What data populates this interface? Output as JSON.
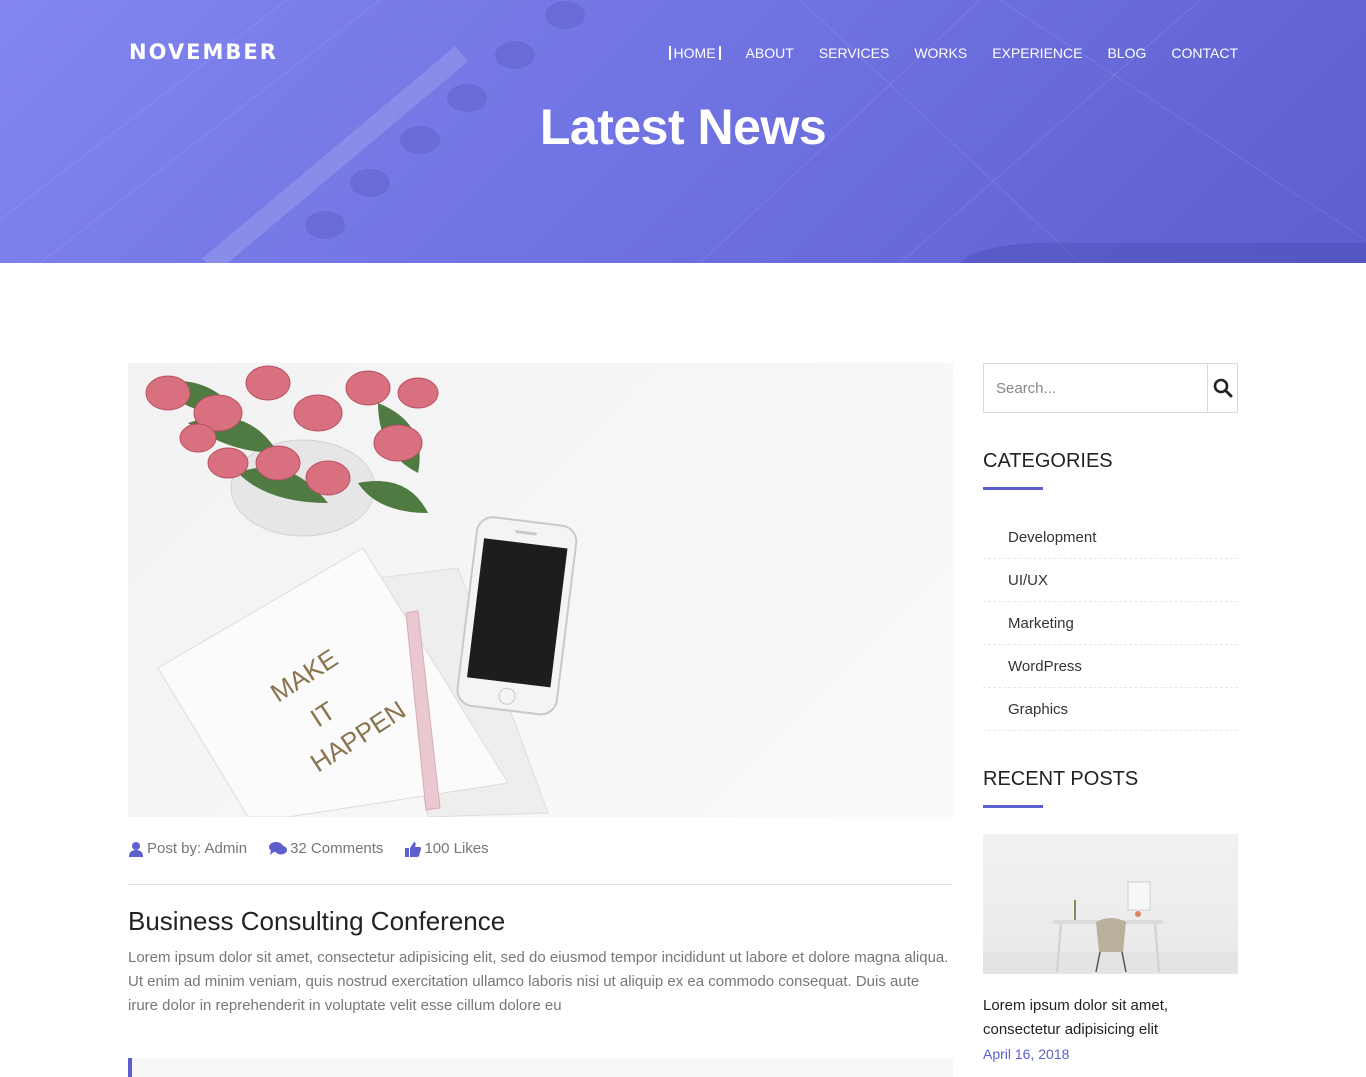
{
  "brand": "NOVEMBER",
  "nav": [
    {
      "label": "HOME",
      "active": true
    },
    {
      "label": "ABOUT"
    },
    {
      "label": "SERVICES"
    },
    {
      "label": "WORKS"
    },
    {
      "label": "EXPERIENCE"
    },
    {
      "label": "BLOG"
    },
    {
      "label": "CONTACT"
    }
  ],
  "hero": {
    "title": "Latest News"
  },
  "post": {
    "image_text": "MAKE IT HAPPEN",
    "meta": {
      "author": "Post by: Admin",
      "comments": "32 Comments",
      "likes": "100 Likes"
    },
    "title": "Business Consulting Conference",
    "excerpt": "Lorem ipsum dolor sit amet, consectetur adipisicing elit, sed do eiusmod tempor incididunt ut labore et dolore magna aliqua. Ut enim ad minim veniam, quis nostrud exercitation ullamco laboris nisi ut aliquip ex ea commodo consequat. Duis aute irure dolor in reprehenderit in voluptate velit esse cillum dolore eu"
  },
  "sidebar": {
    "search_placeholder": "Search...",
    "categories_title": "CATEGORIES",
    "categories": [
      "Development",
      "UI/UX",
      "Marketing",
      "WordPress",
      "Graphics"
    ],
    "recent_title": "RECENT POSTS",
    "recent_post": {
      "title": "Lorem ipsum dolor sit amet, consectetur adipisicing elit",
      "date": "April 16, 2018"
    }
  },
  "colors": {
    "accent": "#5d5fce",
    "hero_start": "#8286ee",
    "hero_end": "#5e5fcf"
  }
}
